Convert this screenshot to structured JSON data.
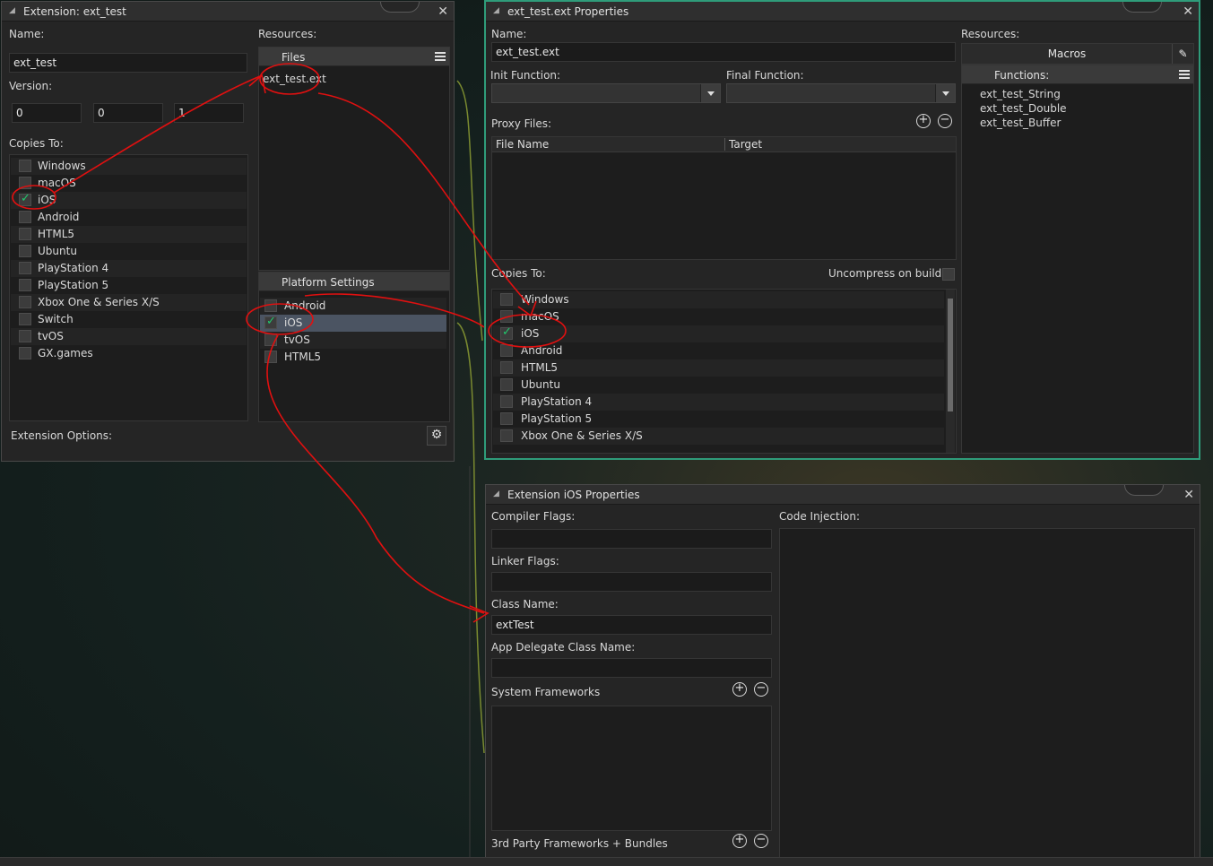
{
  "extension_window": {
    "title": "Extension: ext_test",
    "name_label": "Name:",
    "name_value": "ext_test",
    "version_label": "Version:",
    "version": [
      "0",
      "0",
      "1"
    ],
    "copies_to_label": "Copies To:",
    "platforms": [
      {
        "label": "Windows",
        "checked": false
      },
      {
        "label": "macOS",
        "checked": false
      },
      {
        "label": "iOS",
        "checked": true
      },
      {
        "label": "Android",
        "checked": false
      },
      {
        "label": "HTML5",
        "checked": false
      },
      {
        "label": "Ubuntu",
        "checked": false
      },
      {
        "label": "PlayStation 4",
        "checked": false
      },
      {
        "label": "PlayStation 5",
        "checked": false
      },
      {
        "label": "Xbox One & Series X/S",
        "checked": false
      },
      {
        "label": "Switch",
        "checked": false
      },
      {
        "label": "tvOS",
        "checked": false
      },
      {
        "label": "GX.games",
        "checked": false
      }
    ],
    "resources_label": "Resources:",
    "files_header": "Files",
    "files": [
      "ext_test.ext"
    ],
    "platform_settings_header": "Platform Settings",
    "platform_settings": [
      {
        "label": "Android",
        "checked": false
      },
      {
        "label": "iOS",
        "checked": true
      },
      {
        "label": "tvOS",
        "checked": false
      },
      {
        "label": "HTML5",
        "checked": false
      }
    ],
    "extension_options_label": "Extension Options:"
  },
  "properties_window": {
    "title": "ext_test.ext Properties",
    "name_label": "Name:",
    "name_value": "ext_test.ext",
    "init_function_label": "Init Function:",
    "final_function_label": "Final Function:",
    "proxy_files_label": "Proxy Files:",
    "proxy_columns": [
      "File Name",
      "Target"
    ],
    "copies_to_label": "Copies To:",
    "uncompress_label": "Uncompress on build",
    "platforms": [
      {
        "label": "Windows",
        "checked": false
      },
      {
        "label": "macOS",
        "checked": false
      },
      {
        "label": "iOS",
        "checked": true
      },
      {
        "label": "Android",
        "checked": false
      },
      {
        "label": "HTML5",
        "checked": false
      },
      {
        "label": "Ubuntu",
        "checked": false
      },
      {
        "label": "PlayStation 4",
        "checked": false
      },
      {
        "label": "PlayStation 5",
        "checked": false
      },
      {
        "label": "Xbox One & Series X/S",
        "checked": false
      }
    ],
    "resources_label": "Resources:",
    "macros_button": "Macros",
    "functions_header": "Functions:",
    "functions": [
      "ext_test_String",
      "ext_test_Double",
      "ext_test_Buffer"
    ]
  },
  "ios_window": {
    "title": "Extension iOS Properties",
    "compiler_flags_label": "Compiler Flags:",
    "compiler_flags_value": "",
    "linker_flags_label": "Linker Flags:",
    "linker_flags_value": "",
    "class_name_label": "Class Name:",
    "class_name_value": "extTest",
    "app_delegate_label": "App Delegate Class Name:",
    "app_delegate_value": "",
    "system_frameworks_label": "System Frameworks",
    "third_party_label": "3rd Party Frameworks + Bundles",
    "code_injection_label": "Code Injection:"
  },
  "icons": {
    "add": "+",
    "remove": "−",
    "close": "✕",
    "gear": "⚙",
    "pencil": "✎",
    "collapse": "◢",
    "check": "✓"
  },
  "colors": {
    "active_border": "#2f9c7a",
    "annotation": "#e01010",
    "checkmark": "#22c76d"
  }
}
